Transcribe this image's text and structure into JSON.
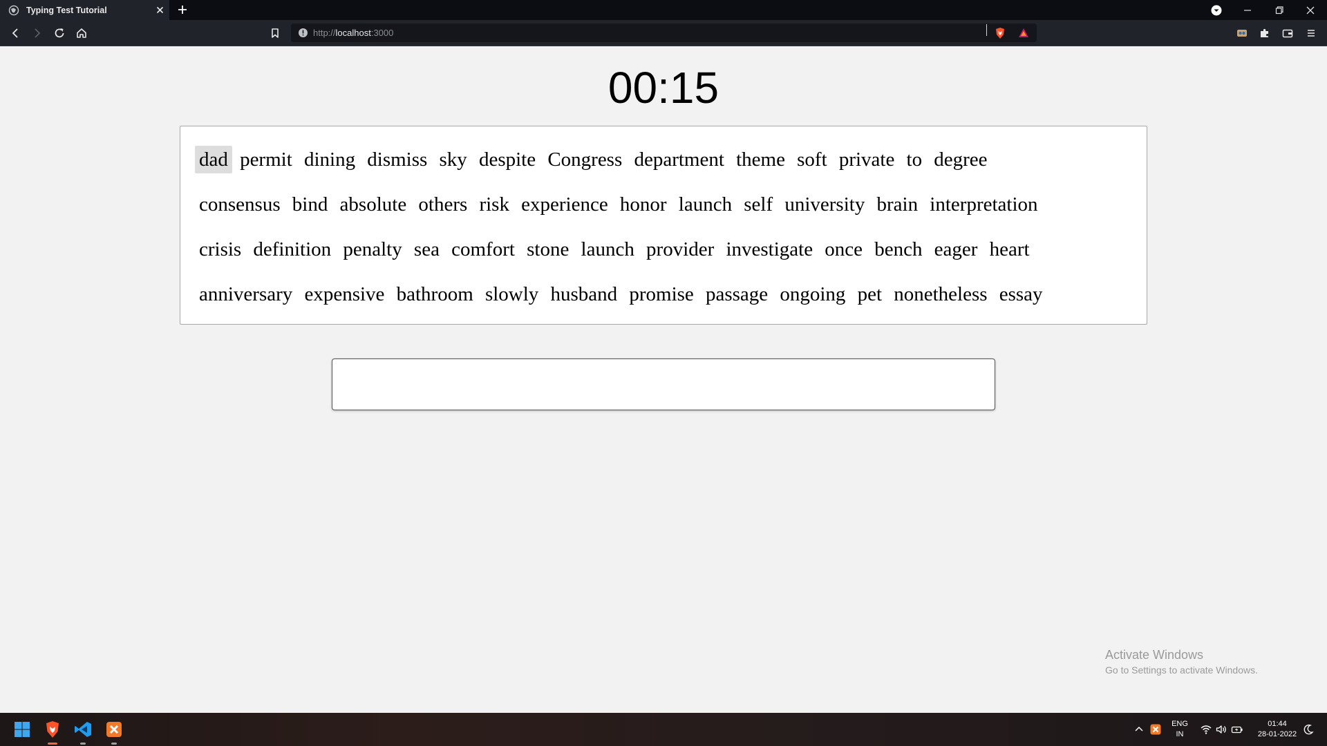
{
  "browser": {
    "tab_title": "Typing Test Tutorial",
    "url_scheme": "http://",
    "url_host": "localhost",
    "url_port": ":3000"
  },
  "app": {
    "timer": "00:15",
    "word_lines": [
      [
        "dad",
        "permit",
        "dining",
        "dismiss",
        "sky",
        "despite",
        "Congress",
        "department",
        "theme",
        "soft",
        "private",
        "to",
        "degree"
      ],
      [
        "consensus",
        "bind",
        "absolute",
        "others",
        "risk",
        "experience",
        "honor",
        "launch",
        "self",
        "university",
        "brain",
        "interpretation"
      ],
      [
        "crisis",
        "definition",
        "penalty",
        "sea",
        "comfort",
        "stone",
        "launch",
        "provider",
        "investigate",
        "once",
        "bench",
        "eager",
        "heart"
      ],
      [
        "anniversary",
        "expensive",
        "bathroom",
        "slowly",
        "husband",
        "promise",
        "passage",
        "ongoing",
        "pet",
        "nonetheless",
        "essay"
      ]
    ],
    "current_word_index": 0,
    "input_value": ""
  },
  "watermark": {
    "title": "Activate Windows",
    "subtitle": "Go to Settings to activate Windows."
  },
  "taskbar": {
    "lang_primary": "ENG",
    "lang_secondary": "IN",
    "time": "01:44",
    "date": "28-01-2022"
  }
}
